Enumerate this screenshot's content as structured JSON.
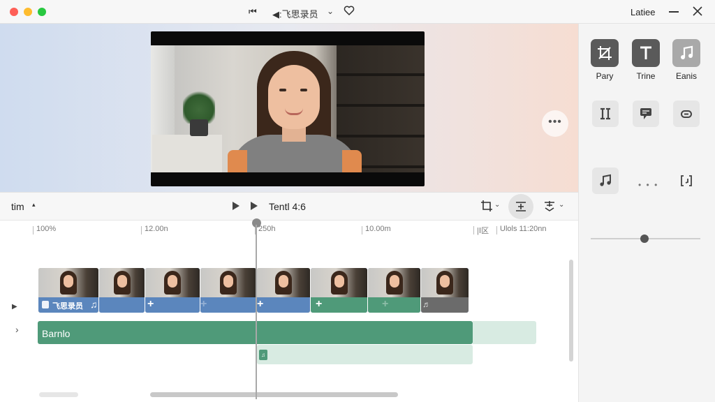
{
  "window": {
    "title": "◀:飞思录员",
    "prev_symbol": "⏮",
    "chevron": "⌄",
    "app_name": "Latiee",
    "close_symbol": "✕"
  },
  "preview": {
    "more_label": "•••"
  },
  "toolbar": {
    "left_label": "tim",
    "left_caret": "▴",
    "time_label": "Tentl 4:6",
    "dropdown_chevron": "⌄"
  },
  "timeline": {
    "ruler_ticks": [
      "100%",
      "12.00n",
      "250h",
      "10.00m",
      "|Ⅰ区",
      "Ulols  11:20nn"
    ],
    "playhead_fraction": 0.37,
    "video_track": {
      "first_clip_label": "飞思录员",
      "plus_symbol": "+",
      "note_symbol": "♫",
      "gray_note_symbol": "♬"
    },
    "audio_track": {
      "name": "Barnlo",
      "sub_chip": "♫"
    },
    "toggle_symbols": [
      "▶",
      "›"
    ]
  },
  "right_panel": {
    "tiles": [
      {
        "label": "Pary",
        "icon": "crop-icon"
      },
      {
        "label": "Trine",
        "icon": "text-icon"
      },
      {
        "label": "Eanis",
        "icon": "music-icon"
      }
    ],
    "row2_icons": [
      "pause-icon",
      "subtitle-icon",
      "link-icon"
    ],
    "row3_icons": [
      "music-note-icon",
      "more-icon",
      "bracket-icon"
    ],
    "more_label": "• • •",
    "slider_value": 0.45
  },
  "colors": {
    "clip_blue": "#5b86bd",
    "clip_green": "#4f9a79",
    "clip_gray": "#6b6b6b",
    "audio_light": "#d8ebe2"
  }
}
